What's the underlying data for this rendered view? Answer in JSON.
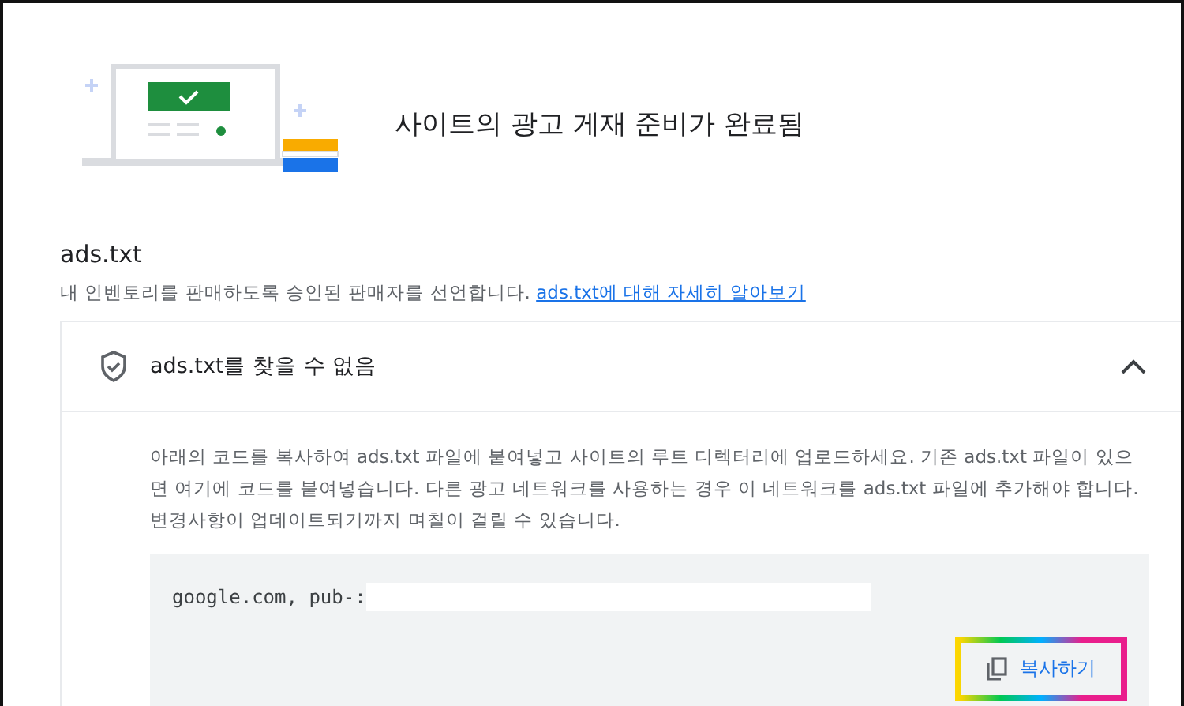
{
  "header": {
    "title": "사이트의 광고 게재 준비가 완료됨"
  },
  "section": {
    "title": "ads.txt",
    "description": "내 인벤토리를 판매하도록 승인된 판매자를 선언합니다.",
    "link": "ads.txt에 대해 자세히 알아보기"
  },
  "panel": {
    "title": "ads.txt를 찾을 수 없음",
    "expanded": true,
    "instructions": "아래의 코드를 복사하여 ads.txt 파일에 붙여넣고 사이트의 루트 디렉터리에 업로드하세요. 기존 ads.txt 파일이 있으면 여기에 코드를 붙여넣습니다. 다른 광고 네트워크를 사용하는 경우 이 네트워크를 ads.txt 파일에 추가해야 합니다. 변경사항이 업데이트되기까지 며칠이 걸릴 수 있습니다.",
    "code": "google.com, pub-:",
    "copy_button": "복사하기"
  }
}
